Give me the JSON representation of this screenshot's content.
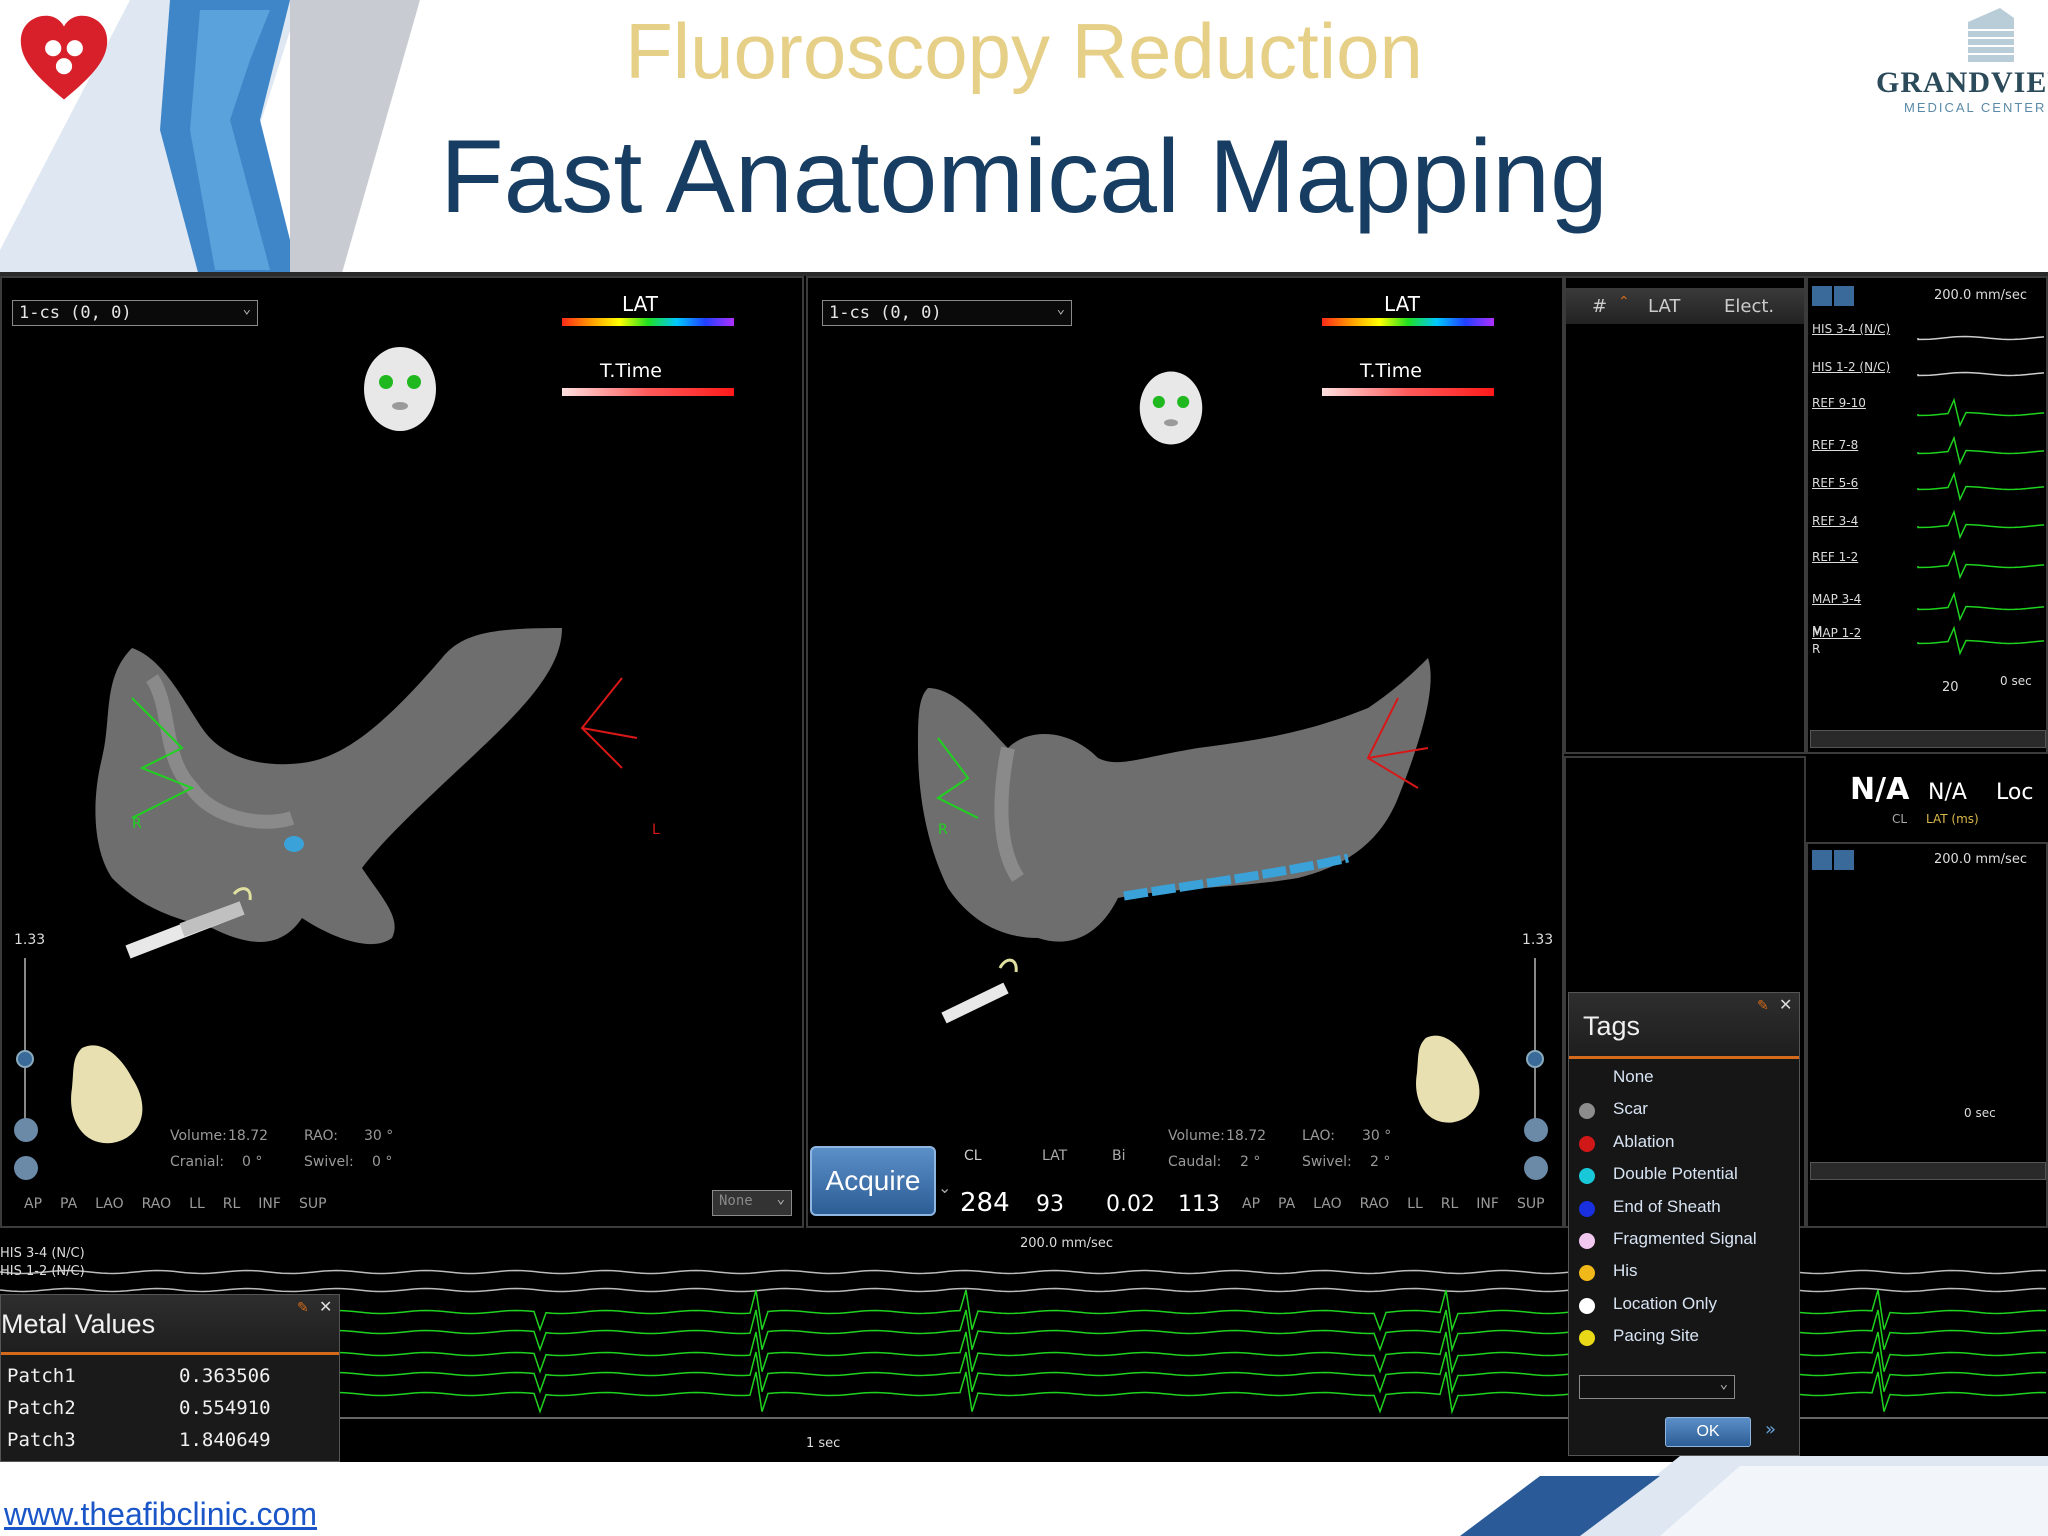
{
  "slide": {
    "subtitle": "Fluoroscopy Reduction",
    "title": "Fast Anatomical Mapping",
    "right_logo_name": "GRANDVIEW",
    "right_logo_sub": "MEDICAL CENTER",
    "footer_link": "www.theafibclinic.com"
  },
  "map_left": {
    "dropdown": "1-cs (0, 0)",
    "colorbar_label": "LAT",
    "ttime_label": "T.Time",
    "scale_value": "1.33",
    "volume_label": "Volume:",
    "volume_value": "18.72",
    "proj1_label": "RAO:",
    "proj1_value": "30 °",
    "cranial_label": "Cranial:",
    "cranial_value": "0 °",
    "swivel_label": "Swivel:",
    "swivel_value": "0 °",
    "marker_r": "R",
    "marker_l": "L",
    "views": [
      "AP",
      "PA",
      "LAO",
      "RAO",
      "LL",
      "RL",
      "INF",
      "SUP"
    ],
    "none_select": "None"
  },
  "map_right": {
    "dropdown": "1-cs (0, 0)",
    "colorbar_label": "LAT",
    "ttime_label": "T.Time",
    "scale_value": "1.33",
    "volume_label": "Volume:",
    "volume_value": "18.72",
    "proj1_label": "LAO:",
    "proj1_value": "30 °",
    "cranial_label": "Caudal:",
    "cranial_value": "2 °",
    "swivel_label": "Swivel:",
    "swivel_value": "2 °",
    "marker_r": "R",
    "views": [
      "AP",
      "PA",
      "LAO",
      "RAO",
      "LL",
      "RL",
      "INF",
      "SUP"
    ]
  },
  "toolbar": {
    "count": "12"
  },
  "acquire": {
    "button": "Acquire",
    "cl_label": "CL",
    "lat_label": "LAT",
    "bi_label": "Bi",
    "cl_value": "284",
    "lat_value": "93",
    "bi_value": "0.02",
    "extra_value": "113"
  },
  "points_table": {
    "col_hash": "#",
    "col_lat": "LAT",
    "col_elect": "Elect."
  },
  "egm_top": {
    "speed": "200.0 mm/sec",
    "channels": [
      "HIS 3-4 (N/C)",
      "HIS 1-2 (N/C)",
      "REF 9-10",
      "REF 7-8",
      "REF 5-6",
      "REF 3-4",
      "REF 1-2",
      "MAP 3-4",
      "MAP 1-2"
    ],
    "r_marker": "R",
    "m_marker": "M",
    "tick_20": "20",
    "sec_label": "0 sec"
  },
  "readout": {
    "na_cl": "N/A",
    "na_lat": "N/A",
    "loc": "Loc",
    "cl_unit": "CL",
    "lat_unit": "LAT (ms)"
  },
  "egm_mid": {
    "speed": "200.0 mm/sec",
    "sec_label": "0 sec"
  },
  "egm_bottom": {
    "speed": "200.0 mm/sec",
    "ch1": "HIS 3-4 (N/C)",
    "ch2": "HIS 1-2 (N/C)",
    "sec": "1 sec"
  },
  "metal_values": {
    "title": "Metal Values",
    "rows": [
      {
        "name": "Patch1",
        "value": "0.363506"
      },
      {
        "name": "Patch2",
        "value": "0.554910"
      },
      {
        "name": "Patch3",
        "value": "1.840649"
      }
    ]
  },
  "tags": {
    "title": "Tags",
    "items": [
      {
        "label": "None",
        "color": ""
      },
      {
        "label": "Scar",
        "color": "#8c8c8c"
      },
      {
        "label": "Ablation",
        "color": "#d01818"
      },
      {
        "label": "Double Potential",
        "color": "#18c8d8"
      },
      {
        "label": "End of Sheath",
        "color": "#1830e0"
      },
      {
        "label": "Fragmented Signal",
        "color": "#f0c8f0"
      },
      {
        "label": "His",
        "color": "#f0b818"
      },
      {
        "label": "Location Only",
        "color": "#ffffff"
      },
      {
        "label": "Pacing Site",
        "color": "#e8d818"
      }
    ],
    "ok": "OK",
    "more": "»"
  },
  "colors": {
    "title_blue": "#173e62",
    "subtitle_gold": "#e6cf86",
    "ecg_green": "#1fd21f",
    "accent_orange": "#d46a1a"
  }
}
